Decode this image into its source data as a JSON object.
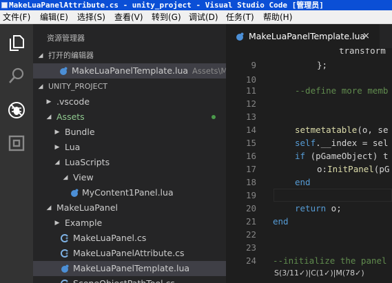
{
  "titlebar": {
    "title": "MakeLuaPanelAttribute.cs - unity_project - Visual Studio Code [管理员]"
  },
  "menubar": {
    "items": [
      "文件(F)",
      "编辑(E)",
      "选择(S)",
      "查看(V)",
      "转到(G)",
      "调试(D)",
      "任务(T)",
      "帮助(H)"
    ]
  },
  "activitybar": {
    "icons": [
      "files-icon",
      "search-icon",
      "debug-icon",
      "extensions-icon"
    ]
  },
  "sidebar": {
    "title": "资源管理器",
    "open_editors": {
      "header": "打开的编辑器",
      "items": [
        {
          "name": "MakeLuaPanelTemplate.lua",
          "path": "Assets\\M..."
        }
      ]
    },
    "project": {
      "header": "UNITY_PROJECT",
      "items": [
        {
          "label": ".vscode"
        },
        {
          "label": "Assets"
        },
        {
          "label": "Bundle"
        },
        {
          "label": "Lua"
        },
        {
          "label": "LuaScripts"
        },
        {
          "label": "View"
        },
        {
          "label": "MyContent1Panel.lua"
        },
        {
          "label": "MakeLuaPanel"
        },
        {
          "label": "Example"
        },
        {
          "label": "MakeLuaPanel.cs"
        },
        {
          "label": "MakeLuaPanelAttribute.cs"
        },
        {
          "label": "MakeLuaPanelTemplate.lua"
        },
        {
          "label": "SceneObjectPathTool.cs"
        }
      ]
    }
  },
  "editor": {
    "tab": {
      "label": "MakeLuaPanelTemplate.lua",
      "close": "×"
    },
    "line_numbers": [
      "",
      "9",
      "10",
      "11",
      "12",
      "13",
      "14",
      "15",
      "16",
      "17",
      "18",
      "19",
      "20",
      "21",
      "22",
      "23",
      "24"
    ],
    "code": {
      "l8": "transform",
      "l9": "};",
      "l11": "--define more memb",
      "l14a": "setmetatable",
      "l14b": "(o, se",
      "l15a": "self",
      "l15b": ".__index = sel",
      "l16a": "if",
      "l16b": " (pGameObject) t",
      "l17a": "o:",
      "l17b": "InitPanel",
      "l17c": "(pG",
      "l18": "end",
      "l20a": "return",
      "l20b": " o;",
      "l21": "end",
      "l24": "--initialize the panel"
    },
    "status": "S(3/11✓)|C(1✓)|M(78✓)"
  },
  "colors": {
    "titlebar": "#0b4fd6",
    "activitybar": "#333333",
    "sidebar": "#252526",
    "editor": "#1e1e1e",
    "selection": "#3f3f46",
    "keyword": "#569cd6",
    "function": "#dcdcaa",
    "comment": "#608b4e",
    "lua_icon": "#4c8fd6",
    "cs_icon": "#7fb3e6"
  }
}
